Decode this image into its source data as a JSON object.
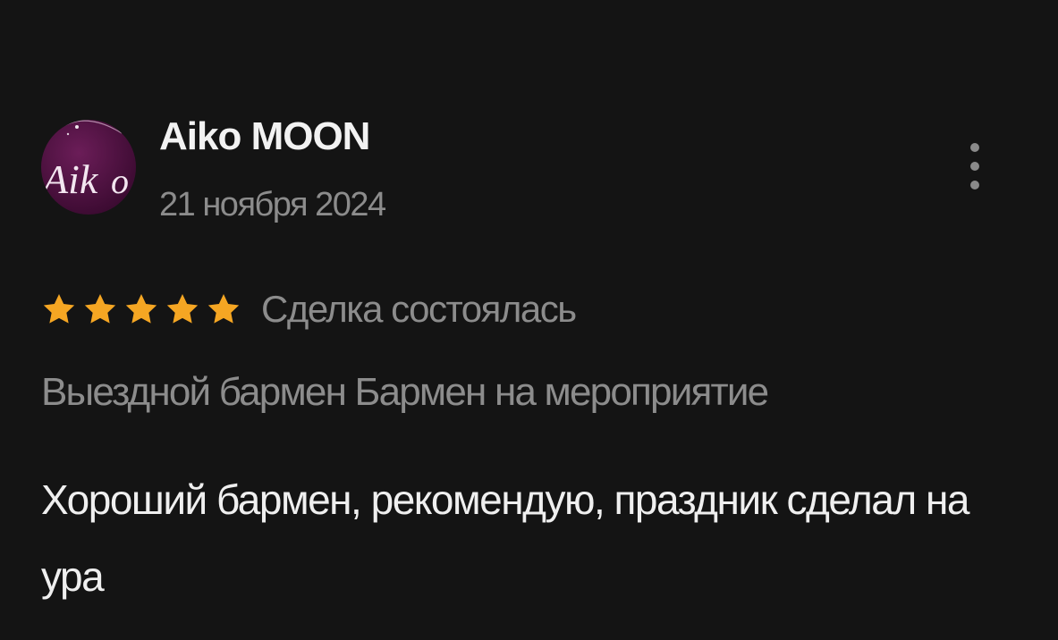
{
  "review": {
    "author": {
      "name": "Aiko MOON",
      "avatar_icon": "aiko-moon-logo-avatar"
    },
    "date": "21 ноября 2024",
    "menu_icon": "more-vertical-icon",
    "rating": {
      "stars": 5,
      "max": 5,
      "star_icon": "star-icon",
      "star_color": "#f5a623"
    },
    "deal_status": "Сделка состоялась",
    "service": "Выездной бармен Бармен на мероприятие",
    "text": "Хороший бармен, рекомендую, праздник сделал на ура"
  },
  "colors": {
    "background": "#141414",
    "primary_text": "#f2f2f2",
    "secondary_text": "#8c8c8c",
    "avatar_bg": "#4a0f3c"
  }
}
